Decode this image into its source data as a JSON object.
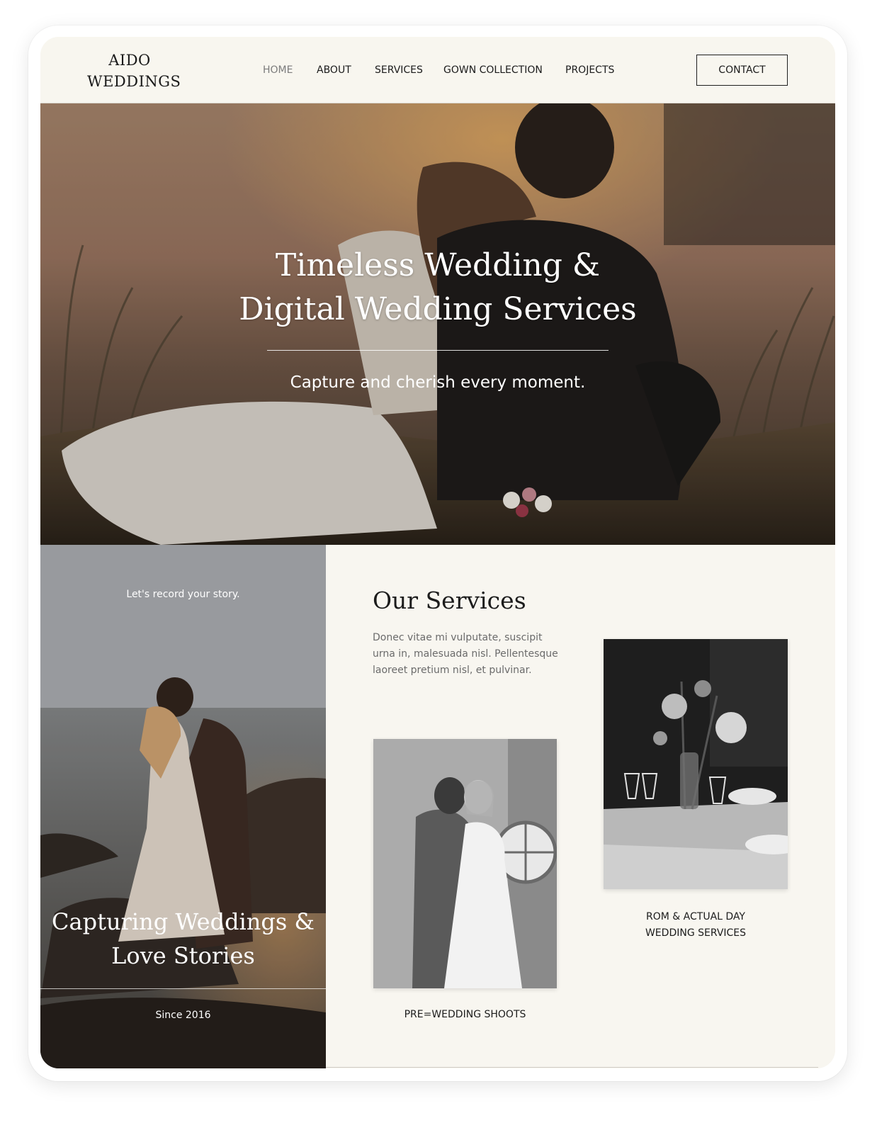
{
  "brand": {
    "line1": "AIDO",
    "line2": "WEDDINGS"
  },
  "nav": {
    "items": [
      {
        "label": "HOME",
        "active": true
      },
      {
        "label": "ABOUT",
        "active": false
      },
      {
        "label": "SERVICES",
        "active": false
      },
      {
        "label": "GOWN COLLECTION",
        "active": false
      },
      {
        "label": "PROJECTS",
        "active": false
      }
    ],
    "contact_label": "CONTACT"
  },
  "hero": {
    "title_line1": "Timeless Wedding &",
    "title_line2": "Digital Wedding Services",
    "subtitle": "Capture and cherish every moment."
  },
  "story": {
    "tagline": "Let's record your story.",
    "title_line1": "Capturing Weddings &",
    "title_line2": "Love Stories",
    "since": "Since 2016"
  },
  "services": {
    "title": "Our Services",
    "description": "Donec vitae mi vulputate, suscipit urna in, malesuada nisl. Pellentesque laoreet pretium nisl, et pulvinar.",
    "cards": [
      {
        "caption_line1": "PRE=WEDDING SHOOTS",
        "caption_line2": ""
      },
      {
        "caption_line1": "ROM & ACTUAL DAY",
        "caption_line2": "WEDDING SERVICES"
      }
    ]
  },
  "colors": {
    "background": "#f8f6f0",
    "text": "#1c1c1c",
    "muted": "#6b6b6b",
    "nav_active": "#7c7c7c",
    "story_panel": "#a0a2a6"
  }
}
